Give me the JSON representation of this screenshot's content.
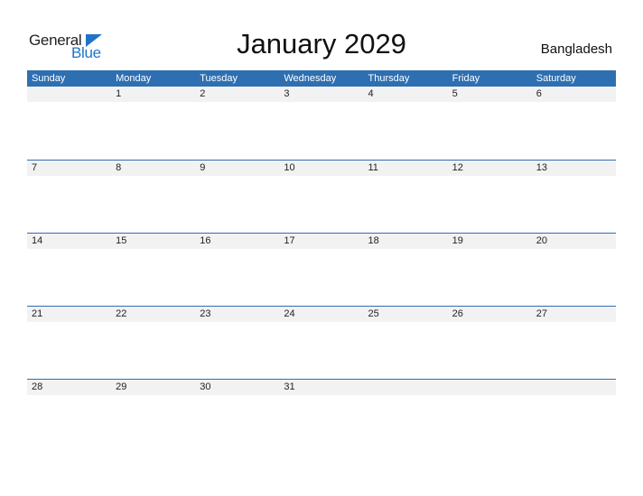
{
  "logo": {
    "word1": "General",
    "word2": "Blue",
    "icon": "triangle-flag-icon",
    "accent_color": "#1f74c8"
  },
  "title": "January 2029",
  "country": "Bangladesh",
  "header_color": "#2e6fb2",
  "weekdays": [
    "Sunday",
    "Monday",
    "Tuesday",
    "Wednesday",
    "Thursday",
    "Friday",
    "Saturday"
  ],
  "weeks": [
    [
      "",
      "1",
      "2",
      "3",
      "4",
      "5",
      "6"
    ],
    [
      "7",
      "8",
      "9",
      "10",
      "11",
      "12",
      "13"
    ],
    [
      "14",
      "15",
      "16",
      "17",
      "18",
      "19",
      "20"
    ],
    [
      "21",
      "22",
      "23",
      "24",
      "25",
      "26",
      "27"
    ],
    [
      "28",
      "29",
      "30",
      "31",
      "",
      "",
      ""
    ]
  ]
}
